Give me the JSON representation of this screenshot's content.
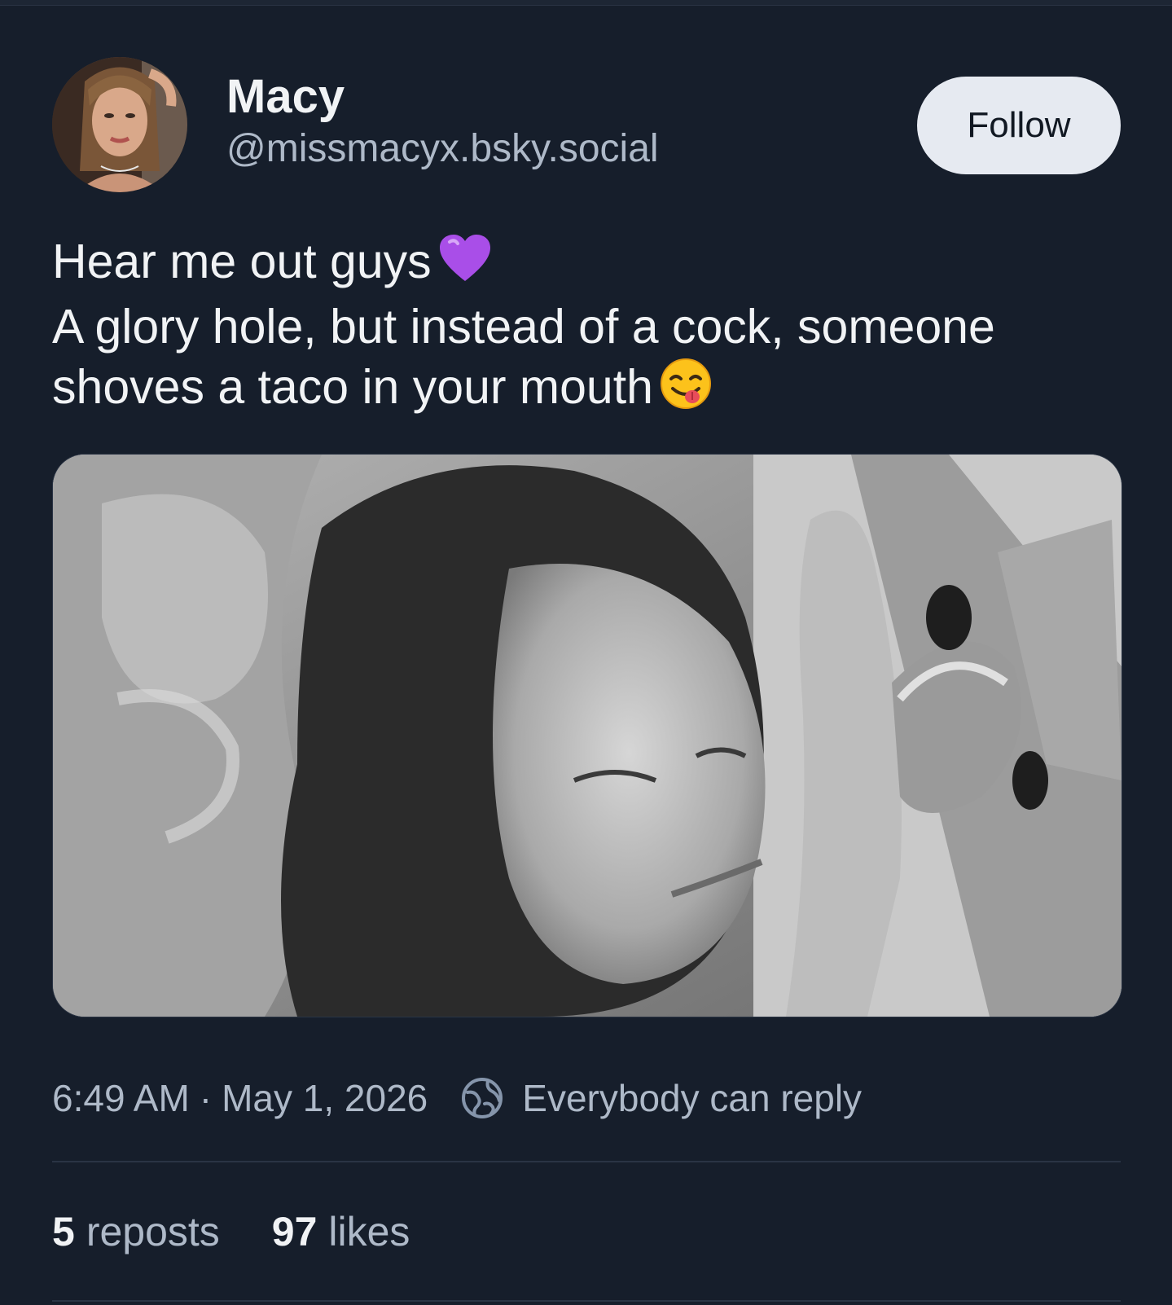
{
  "post": {
    "author": {
      "display_name": "Macy",
      "handle": "@missmacyx.bsky.social",
      "avatar_icon": "user-avatar-photo"
    },
    "follow_label": "Follow",
    "text_lines": [
      "Hear me out guys",
      "A glory hole, but instead of a cock, someone",
      "shoves a taco in your mouth"
    ],
    "emojis": {
      "line1": "purple-heart-emoji",
      "line3": "face-savoring-food-emoji"
    },
    "media_icon": "attached-photo",
    "time": "6:49 AM",
    "separator": "·",
    "date": "May 1, 2026",
    "reply_setting_icon": "globe-icon",
    "reply_setting": "Everybody can reply",
    "stats": {
      "reposts_count": "5",
      "reposts_label": "reposts",
      "likes_count": "97",
      "likes_label": "likes"
    }
  },
  "colors": {
    "background": "#161e2b",
    "text_primary": "#f1f3f5",
    "text_secondary": "#aeb9c8",
    "follow_button_bg": "#e6eaf1",
    "divider": "#2a3444"
  }
}
